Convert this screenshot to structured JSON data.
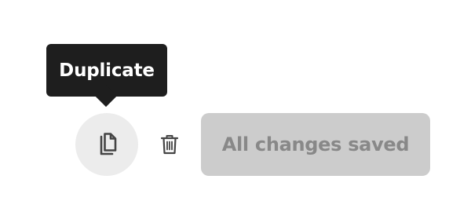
{
  "tooltip": {
    "label": "Duplicate"
  },
  "actions": {
    "duplicate_icon": "duplicate-icon",
    "delete_icon": "trash-icon"
  },
  "status": {
    "label": "All changes saved"
  },
  "colors": {
    "tooltip_bg": "#1e1e1e",
    "tooltip_text": "#ffffff",
    "duplicate_bg": "#ececec",
    "icon": "#444444",
    "status_bg": "#cccccc",
    "status_text": "#888888"
  }
}
